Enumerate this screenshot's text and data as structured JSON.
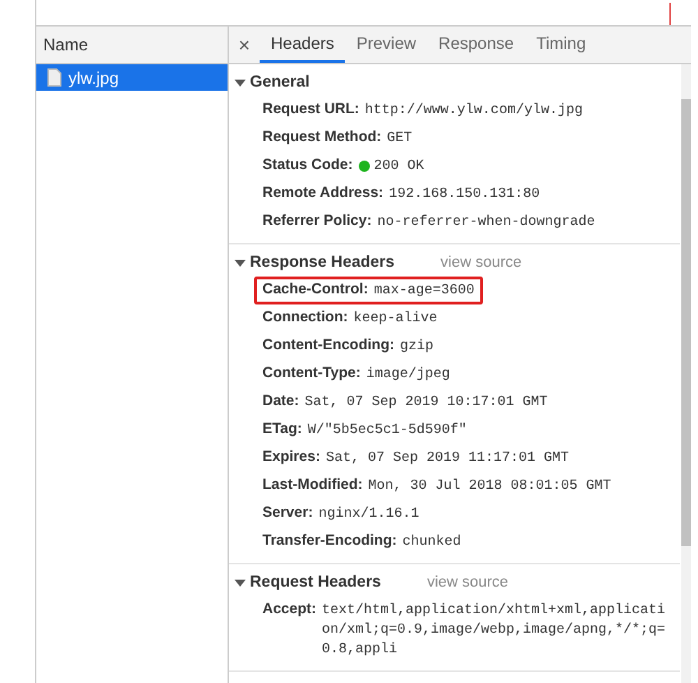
{
  "request_list": {
    "column": "Name",
    "items": [
      {
        "name": "ylw.jpg",
        "selected": true
      }
    ]
  },
  "detail_tabs": {
    "close": "×",
    "tabs": [
      {
        "label": "Headers",
        "selected": true
      },
      {
        "label": "Preview",
        "selected": false
      },
      {
        "label": "Response",
        "selected": false
      },
      {
        "label": "Timing",
        "selected": false
      }
    ]
  },
  "sections": [
    {
      "title": "General",
      "expanded": true,
      "items": [
        {
          "name": "Request URL:",
          "value": "http://www.ylw.com/ylw.jpg",
          "kind": "plain",
          "highlighted": false
        },
        {
          "name": "Request Method:",
          "value": "GET",
          "kind": "plain",
          "highlighted": false
        },
        {
          "name": "Status Code:",
          "value": "200 OK",
          "kind": "status",
          "highlighted": false
        },
        {
          "name": "Remote Address:",
          "value": "192.168.150.131:80",
          "kind": "plain",
          "highlighted": false
        },
        {
          "name": "Referrer Policy:",
          "value": "no-referrer-when-downgrade",
          "kind": "plain",
          "highlighted": false
        }
      ]
    },
    {
      "title": "Response Headers",
      "link": "view source",
      "expanded": true,
      "items": [
        {
          "name": "Cache-Control:",
          "value": "max-age=3600",
          "kind": "plain",
          "highlighted": true
        },
        {
          "name": "Connection:",
          "value": "keep-alive",
          "kind": "plain",
          "highlighted": false
        },
        {
          "name": "Content-Encoding:",
          "value": "gzip",
          "kind": "plain",
          "highlighted": false
        },
        {
          "name": "Content-Type:",
          "value": "image/jpeg",
          "kind": "plain",
          "highlighted": false
        },
        {
          "name": "Date:",
          "value": "Sat, 07 Sep 2019 10:17:01 GMT",
          "kind": "plain",
          "highlighted": false
        },
        {
          "name": "ETag:",
          "value": "W/\"5b5ec5c1-5d590f\"",
          "kind": "plain",
          "highlighted": false
        },
        {
          "name": "Expires:",
          "value": "Sat, 07 Sep 2019 11:17:01 GMT",
          "kind": "plain",
          "highlighted": false
        },
        {
          "name": "Last-Modified:",
          "value": "Mon, 30 Jul 2018 08:01:05 GMT",
          "kind": "plain",
          "highlighted": false
        },
        {
          "name": "Server:",
          "value": "nginx/1.16.1",
          "kind": "plain",
          "highlighted": false
        },
        {
          "name": "Transfer-Encoding:",
          "value": "chunked",
          "kind": "plain",
          "highlighted": false
        }
      ]
    },
    {
      "title": "Request Headers",
      "link": "view source",
      "expanded": true,
      "items": [
        {
          "name": "Accept:",
          "value": "text/html,application/xhtml+xml,application/xml;q=0.9,image/webp,image/apng,*/*;q=0.8,appli",
          "kind": "plain",
          "highlighted": false
        }
      ]
    }
  ]
}
